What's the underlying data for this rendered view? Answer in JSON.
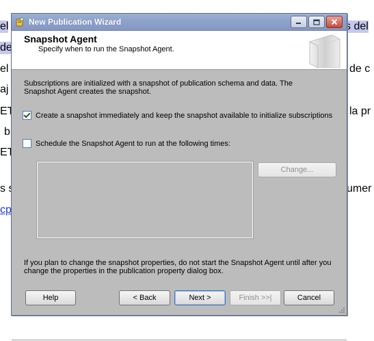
{
  "background_document": {
    "fragments_left": [
      "el",
      "de",
      "el",
      "aj",
      "ET",
      "b",
      "ET",
      "s s",
      "cpi"
    ],
    "fragments_right": [
      "s del",
      "de c",
      "la pr",
      "umer"
    ]
  },
  "window": {
    "title": "New Publication Wizard",
    "title_icon": "wizard-icon",
    "controls": [
      "minimize-icon",
      "maximize-icon",
      "close-icon"
    ]
  },
  "header": {
    "title": "Snapshot Agent",
    "subtitle": "Specify when to run the Snapshot Agent.",
    "graphic": "book-icon"
  },
  "content": {
    "intro": "Subscriptions are initialized with a snapshot of publication schema and data. The Snapshot Agent creates the snapshot.",
    "create_snapshot_label": "Create a snapshot immediately and keep the snapshot available to initialize subscriptions",
    "create_snapshot_checked": true,
    "schedule_label": "Schedule the Snapshot Agent to run at the following times:",
    "schedule_checked": false,
    "change_button": "Change...",
    "note": "If you plan to change the snapshot properties, do not start the Snapshot Agent until after you change the properties in the publication property dialog box."
  },
  "footer": {
    "help": "Help",
    "back": "< Back",
    "next": "Next >",
    "finish": "Finish >>|",
    "cancel": "Cancel"
  },
  "colors": {
    "dialog_bg": "#bcbcbc",
    "titlebar": "#8fa3cc",
    "highlight": "#c5c7ee",
    "link": "#1d3bd8"
  }
}
